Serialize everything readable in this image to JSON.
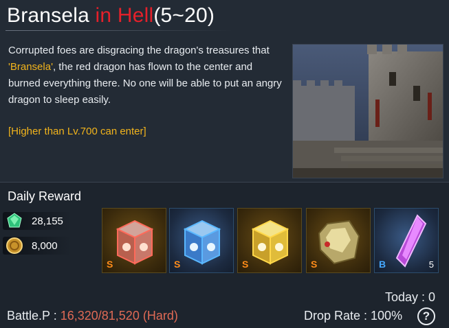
{
  "header": {
    "title_main": "Bransela",
    "title_red": " in Hell",
    "title_range": "(5~20)"
  },
  "description": {
    "part1": "Corrupted foes are disgracing the dragon's treasures that ",
    "highlight": "'Bransela'",
    "part2": ", the red dragon has flown to the center and burned everything there. No one will be able to put an angry dragon to sleep easily.",
    "requirement": "[Higher than Lv.700 can enter]"
  },
  "reward": {
    "title": "Daily Reward",
    "currencies": [
      {
        "icon": "green-gem-icon",
        "amount": "28,155"
      },
      {
        "icon": "gold-coin-icon",
        "amount": "8,000"
      }
    ],
    "items": [
      {
        "icon": "red-chest-icon",
        "grade": "S",
        "qty": ""
      },
      {
        "icon": "blue-chest-icon",
        "grade": "S",
        "qty": ""
      },
      {
        "icon": "gold-chest-icon",
        "grade": "S",
        "qty": ""
      },
      {
        "icon": "gold-ore-icon",
        "grade": "S",
        "qty": ""
      },
      {
        "icon": "purple-crystal-icon",
        "grade": "B",
        "qty": "5"
      }
    ]
  },
  "stats": {
    "today": "Today : 0",
    "battle_label": "Battle.P : ",
    "battle_value": "16,320/81,520 (Hard)",
    "drop_rate": "Drop Rate : 100%",
    "help": "?"
  },
  "colors": {
    "accent_red": "#e5202a",
    "highlight_gold": "#f2b41c",
    "battle_value": "#e06a55",
    "grade_s": "#ff8c1a",
    "grade_b": "#45a8ff"
  }
}
